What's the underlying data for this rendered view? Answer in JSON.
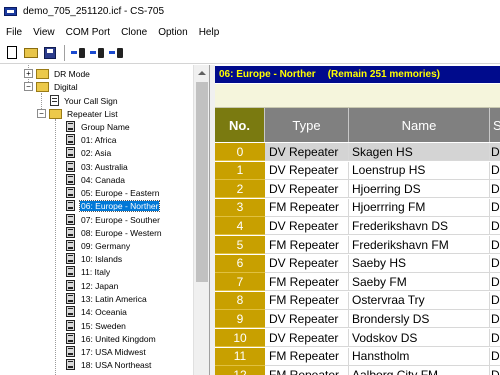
{
  "window": {
    "title": "demo_705_251120.icf - CS-705",
    "app_icon": "cs705-app-icon"
  },
  "menu": [
    "File",
    "View",
    "COM Port",
    "Clone",
    "Option",
    "Help"
  ],
  "toolbar": {
    "buttons": [
      "new-file-icon",
      "open-folder-icon",
      "save-icon",
      "read-from-radio-icon",
      "write-to-radio-icon",
      "clone-radio-icon"
    ]
  },
  "tree": {
    "nodes": [
      {
        "label": "DR Mode",
        "expander": "+"
      },
      {
        "label": "Digital",
        "expander": "-"
      },
      {
        "label": "Your Call Sign"
      },
      {
        "label": "Repeater List",
        "expander": "-"
      },
      {
        "label": "Group Name"
      },
      {
        "label": "01: Africa"
      },
      {
        "label": "02: Asia"
      },
      {
        "label": "03: Australia"
      },
      {
        "label": "04: Canada"
      },
      {
        "label": "05: Europe - Eastern"
      },
      {
        "label": "06: Europe - Norther",
        "selected": true
      },
      {
        "label": "07: Europe - Souther"
      },
      {
        "label": "08: Europe - Western"
      },
      {
        "label": "09: Germany"
      },
      {
        "label": "10: Islands"
      },
      {
        "label": "11: Italy"
      },
      {
        "label": "12: Japan"
      },
      {
        "label": "13: Latin America"
      },
      {
        "label": "14: Oceania"
      },
      {
        "label": "15: Sweden"
      },
      {
        "label": "16: United Kingdom"
      },
      {
        "label": "17: USA Midwest"
      },
      {
        "label": "18: USA Northeast"
      }
    ]
  },
  "header": {
    "group": "06: Europe - Norther",
    "remain": "(Remain 251 memories)"
  },
  "table": {
    "columns": [
      "No.",
      "Type",
      "Name",
      "S"
    ],
    "rows": [
      {
        "no": "0",
        "type": "DV Repeater",
        "name": "Skagen HS",
        "extra": "D"
      },
      {
        "no": "1",
        "type": "DV Repeater",
        "name": "Loenstrup HS",
        "extra": "D"
      },
      {
        "no": "2",
        "type": "DV Repeater",
        "name": "Hjoerring DS",
        "extra": "D"
      },
      {
        "no": "3",
        "type": "FM Repeater",
        "name": "Hjoerrring FM",
        "extra": "D"
      },
      {
        "no": "4",
        "type": "DV Repeater",
        "name": "Frederikshavn DS",
        "extra": "D"
      },
      {
        "no": "5",
        "type": "FM Repeater",
        "name": "Frederikshavn FM",
        "extra": "D"
      },
      {
        "no": "6",
        "type": "DV Repeater",
        "name": "Saeby HS",
        "extra": "D"
      },
      {
        "no": "7",
        "type": "FM Repeater",
        "name": "Saeby FM",
        "extra": "D"
      },
      {
        "no": "8",
        "type": "FM Repeater",
        "name": "Ostervraa  Try",
        "extra": "D"
      },
      {
        "no": "9",
        "type": "DV Repeater",
        "name": "Brondersly DS",
        "extra": "D"
      },
      {
        "no": "10",
        "type": "DV Repeater",
        "name": "Vodskov DS",
        "extra": "D"
      },
      {
        "no": "11",
        "type": "FM Repeater",
        "name": "Hanstholm",
        "extra": "D"
      },
      {
        "no": "12",
        "type": "FM Repeater",
        "name": "Aalborg City FM",
        "extra": "D"
      }
    ]
  }
}
